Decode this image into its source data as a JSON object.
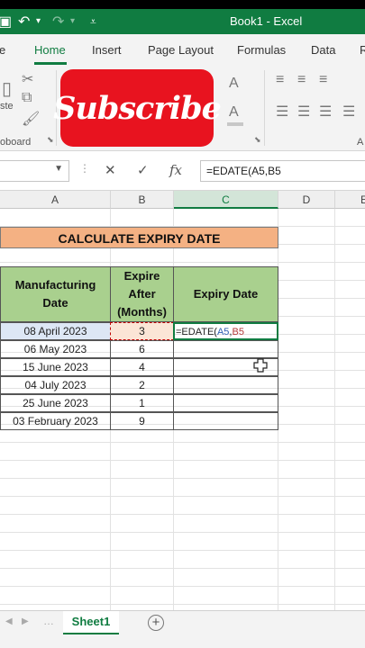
{
  "titlebar": {
    "title": "Book1 - Excel"
  },
  "tabs": [
    {
      "label": "e"
    },
    {
      "label": "Home"
    },
    {
      "label": "Insert"
    },
    {
      "label": "Page Layout"
    },
    {
      "label": "Formulas"
    },
    {
      "label": "Data"
    },
    {
      "label": "R"
    }
  ],
  "ribbon": {
    "clipboard_partial_label": "ste",
    "clipboard_group_label": "oboard",
    "group_right_label": "A"
  },
  "overlay": {
    "subscribe_text": "Subscribe",
    "subscribe_color": "#e8131f"
  },
  "formula_bar": {
    "cancel_icon": "✕",
    "enter_icon": "✓",
    "fx_label": "fx",
    "formula": "=EDATE(A5,B5"
  },
  "columns": [
    {
      "label": "A"
    },
    {
      "label": "B"
    },
    {
      "label": "C"
    },
    {
      "label": "D"
    },
    {
      "label": "E"
    }
  ],
  "sheet": {
    "title": "CALCULATE EXPIRY DATE",
    "headers": {
      "manufacturing": [
        "Manufacturing",
        "Date"
      ],
      "expire": [
        "Expire",
        "After",
        "(Months)"
      ],
      "expiry": "Expiry Date"
    },
    "rows": [
      {
        "date": "08 April 2023",
        "months": "3"
      },
      {
        "date": "06 May 2023",
        "months": "6"
      },
      {
        "date": "15 June 2023",
        "months": "4"
      },
      {
        "date": "04 July 2023",
        "months": "2"
      },
      {
        "date": "25 June 2023",
        "months": "1"
      },
      {
        "date": "03 February 2023",
        "months": "9"
      }
    ],
    "formula_cell_prefix": "=EDATE(",
    "formula_cell_ref_a": "A5",
    "formula_cell_comma": ",",
    "formula_cell_ref_b": "B5"
  },
  "sheet_tabs": {
    "active": "Sheet1",
    "add_icon": "+"
  },
  "colors": {
    "excel_green": "#107c41",
    "title_fill": "#f4b183",
    "header_fill": "#a9d08e"
  }
}
